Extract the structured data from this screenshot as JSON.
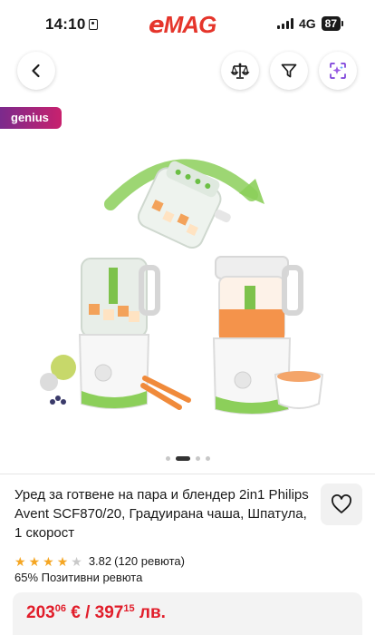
{
  "status_bar": {
    "time": "14:10",
    "network": "4G",
    "battery": "87"
  },
  "brand": {
    "logo_first": "e",
    "logo_rest": "MAG",
    "color": "#e5352b"
  },
  "nav": {
    "back_icon": "chevron-left-icon",
    "compare_icon": "scale-icon",
    "filter_icon": "funnel-icon",
    "ai_icon": "sparkle-icon"
  },
  "badge": {
    "genius": "genius"
  },
  "gallery": {
    "active_index": 2,
    "dot_count": 5
  },
  "product": {
    "title": "Уред за готвене на пара и блендер 2in1 Philips Avent SCF870/20, Градуирана чаша, Шпатула, 1 скорост",
    "rating": {
      "stars": 3.82,
      "value": "3.82",
      "reviews": "(120 ревюта)"
    },
    "positive": "65% Позитивни ревюта",
    "price": {
      "eur_int": "203",
      "eur_dec": "06",
      "eur_symbol": "€ /",
      "bgn_int": "397",
      "bgn_dec": "15",
      "bgn_symbol": "лв."
    }
  },
  "colors": {
    "price_red": "#e11d2a",
    "star_gold": "#f5a623",
    "genius_gradient": "#7b2a8c"
  }
}
